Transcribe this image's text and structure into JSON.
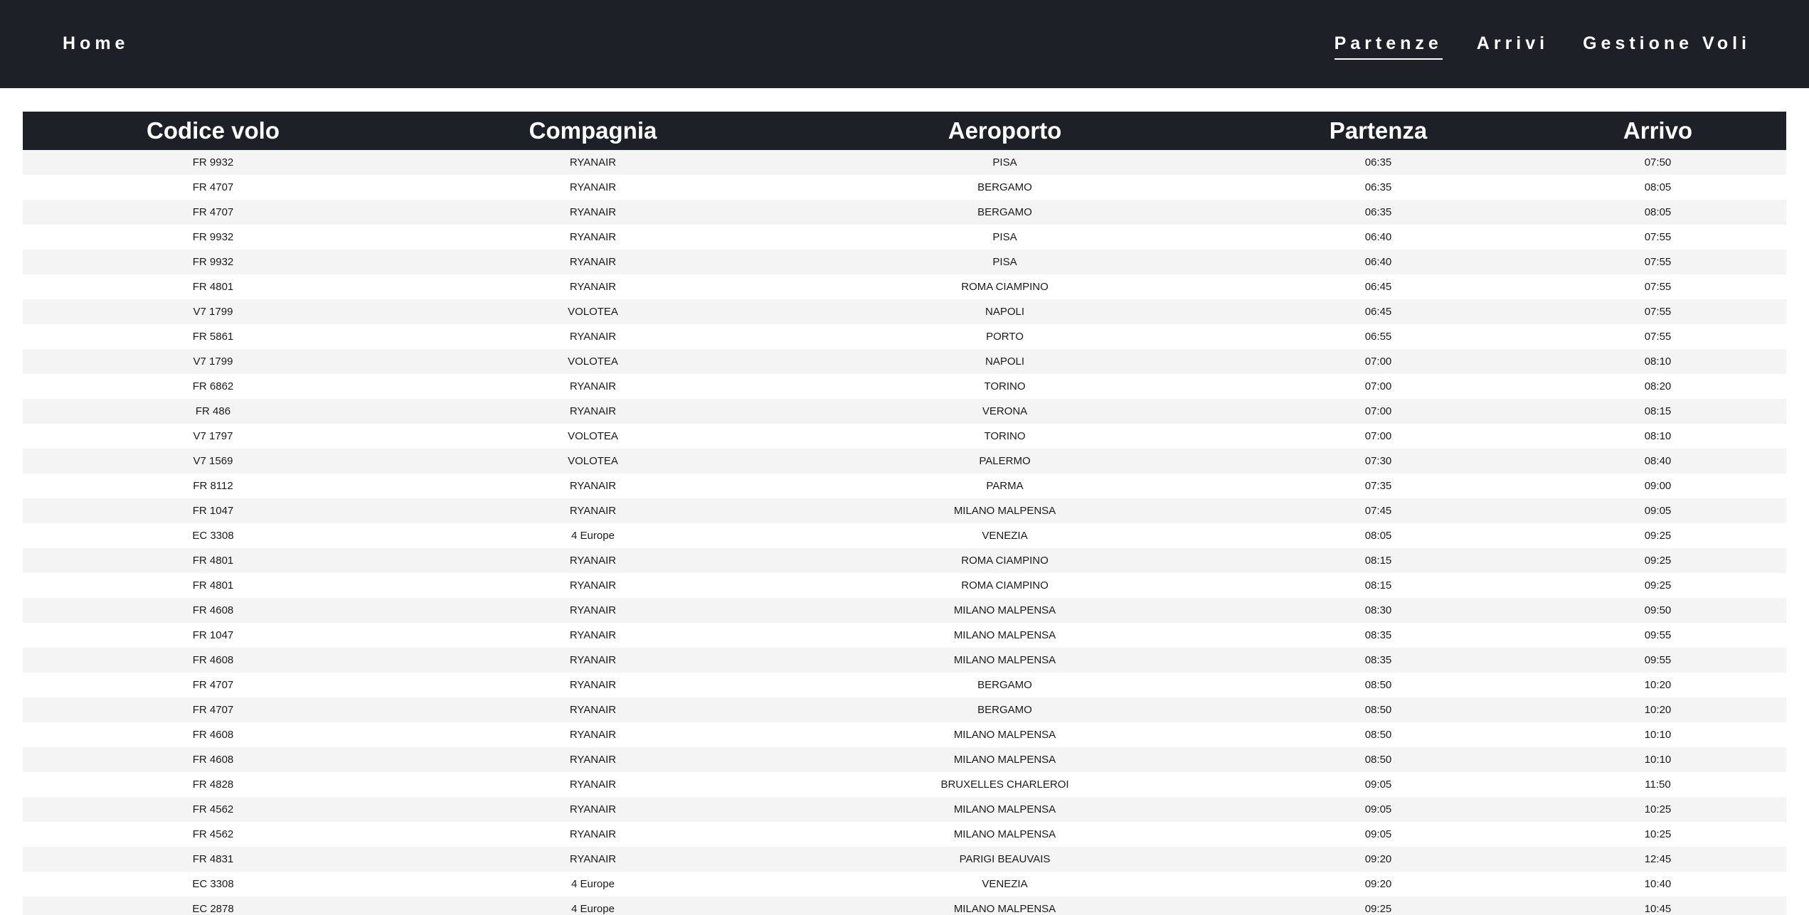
{
  "nav": {
    "home": "Home",
    "links": [
      {
        "label": "Partenze",
        "active": true
      },
      {
        "label": "Arrivi",
        "active": false
      },
      {
        "label": "Gestione Voli",
        "active": false
      }
    ]
  },
  "table": {
    "headers": [
      "Codice volo",
      "Compagnia",
      "Aeroporto",
      "Partenza",
      "Arrivo"
    ],
    "rows": [
      [
        "FR 9932",
        "RYANAIR",
        "PISA",
        "06:35",
        "07:50"
      ],
      [
        "FR 4707",
        "RYANAIR",
        "BERGAMO",
        "06:35",
        "08:05"
      ],
      [
        "FR 4707",
        "RYANAIR",
        "BERGAMO",
        "06:35",
        "08:05"
      ],
      [
        "FR 9932",
        "RYANAIR",
        "PISA",
        "06:40",
        "07:55"
      ],
      [
        "FR 9932",
        "RYANAIR",
        "PISA",
        "06:40",
        "07:55"
      ],
      [
        "FR 4801",
        "RYANAIR",
        "ROMA CIAMPINO",
        "06:45",
        "07:55"
      ],
      [
        "V7 1799",
        "VOLOTEA",
        "NAPOLI",
        "06:45",
        "07:55"
      ],
      [
        "FR 5861",
        "RYANAIR",
        "PORTO",
        "06:55",
        "07:55"
      ],
      [
        "V7 1799",
        "VOLOTEA",
        "NAPOLI",
        "07:00",
        "08:10"
      ],
      [
        "FR 6862",
        "RYANAIR",
        "TORINO",
        "07:00",
        "08:20"
      ],
      [
        "FR 486",
        "RYANAIR",
        "VERONA",
        "07:00",
        "08:15"
      ],
      [
        "V7 1797",
        "VOLOTEA",
        "TORINO",
        "07:00",
        "08:10"
      ],
      [
        "V7 1569",
        "VOLOTEA",
        "PALERMO",
        "07:30",
        "08:40"
      ],
      [
        "FR 8112",
        "RYANAIR",
        "PARMA",
        "07:35",
        "09:00"
      ],
      [
        "FR 1047",
        "RYANAIR",
        "MILANO MALPENSA",
        "07:45",
        "09:05"
      ],
      [
        "EC 3308",
        "4 Europe",
        "VENEZIA",
        "08:05",
        "09:25"
      ],
      [
        "FR 4801",
        "RYANAIR",
        "ROMA CIAMPINO",
        "08:15",
        "09:25"
      ],
      [
        "FR 4801",
        "RYANAIR",
        "ROMA CIAMPINO",
        "08:15",
        "09:25"
      ],
      [
        "FR 4608",
        "RYANAIR",
        "MILANO MALPENSA",
        "08:30",
        "09:50"
      ],
      [
        "FR 1047",
        "RYANAIR",
        "MILANO MALPENSA",
        "08:35",
        "09:55"
      ],
      [
        "FR 4608",
        "RYANAIR",
        "MILANO MALPENSA",
        "08:35",
        "09:55"
      ],
      [
        "FR 4707",
        "RYANAIR",
        "BERGAMO",
        "08:50",
        "10:20"
      ],
      [
        "FR 4707",
        "RYANAIR",
        "BERGAMO",
        "08:50",
        "10:20"
      ],
      [
        "FR 4608",
        "RYANAIR",
        "MILANO MALPENSA",
        "08:50",
        "10:10"
      ],
      [
        "FR 4608",
        "RYANAIR",
        "MILANO MALPENSA",
        "08:50",
        "10:10"
      ],
      [
        "FR 4828",
        "RYANAIR",
        "BRUXELLES CHARLEROI",
        "09:05",
        "11:50"
      ],
      [
        "FR 4562",
        "RYANAIR",
        "MILANO MALPENSA",
        "09:05",
        "10:25"
      ],
      [
        "FR 4562",
        "RYANAIR",
        "MILANO MALPENSA",
        "09:05",
        "10:25"
      ],
      [
        "FR 4831",
        "RYANAIR",
        "PARIGI BEAUVAIS",
        "09:20",
        "12:45"
      ],
      [
        "EC 3308",
        "4 Europe",
        "VENEZIA",
        "09:20",
        "10:40"
      ],
      [
        "EC 2878",
        "4 Europe",
        "MILANO MALPENSA",
        "09:25",
        "10:45"
      ]
    ]
  }
}
